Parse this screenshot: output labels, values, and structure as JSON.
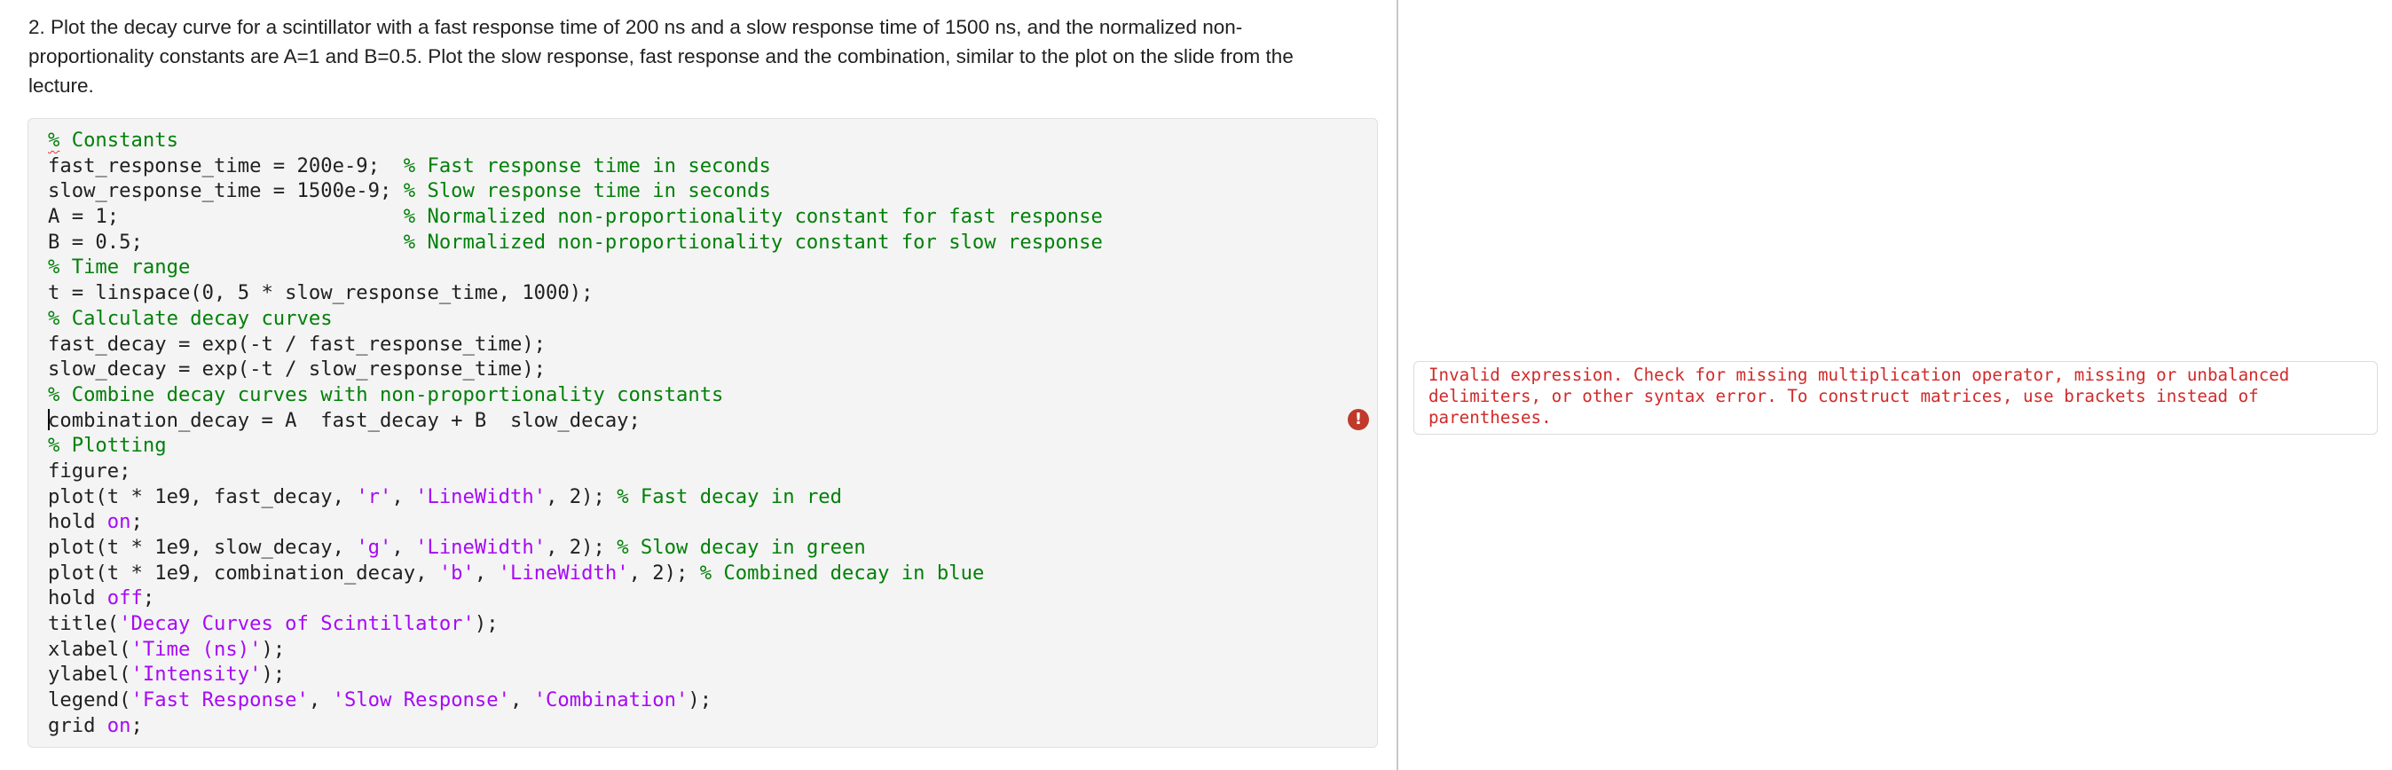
{
  "question": {
    "text": "2. Plot the decay curve for a scintillator with a fast response time of 200 ns and a slow response time of 1500 ns, and the normalized non-proportionality constants are A=1 and B=0.5. Plot the slow response, fast response and the combination, similar to the plot on the slide from the lecture."
  },
  "code": {
    "lines": [
      [
        {
          "t": "% Constants",
          "c": "cm-squiggle"
        }
      ],
      [
        {
          "t": "fast_response_time = 200e-9;  ",
          "c": ""
        },
        {
          "t": "% Fast response time in seconds",
          "c": "cm"
        }
      ],
      [
        {
          "t": "slow_response_time = 1500e-9; ",
          "c": ""
        },
        {
          "t": "% Slow response time in seconds",
          "c": "cm"
        }
      ],
      [
        {
          "t": "A = 1;                        ",
          "c": ""
        },
        {
          "t": "% Normalized non-proportionality constant for fast response",
          "c": "cm"
        }
      ],
      [
        {
          "t": "B = 0.5;                      ",
          "c": ""
        },
        {
          "t": "% Normalized non-proportionality constant for slow response",
          "c": "cm"
        }
      ],
      [
        {
          "t": "% Time range",
          "c": "cm"
        }
      ],
      [
        {
          "t": "t = linspace(0, 5 * slow_response_time, 1000);",
          "c": ""
        }
      ],
      [
        {
          "t": "% Calculate decay curves",
          "c": "cm"
        }
      ],
      [
        {
          "t": "fast_decay = exp(-t / fast_response_time);",
          "c": ""
        }
      ],
      [
        {
          "t": "slow_decay = exp(-t / slow_response_time);",
          "c": ""
        }
      ],
      [
        {
          "t": "% Combine decay curves with non-proportionality constants",
          "c": "cm"
        }
      ],
      [
        {
          "t": "",
          "c": "caret"
        },
        {
          "t": "combination_decay = A  fast_decay + B  slow_decay;",
          "c": ""
        }
      ],
      [
        {
          "t": "% Plotting",
          "c": "cm"
        }
      ],
      [
        {
          "t": "figure;",
          "c": ""
        }
      ],
      [
        {
          "t": "plot(t * 1e9, fast_decay, ",
          "c": ""
        },
        {
          "t": "'r'",
          "c": "st"
        },
        {
          "t": ", ",
          "c": ""
        },
        {
          "t": "'LineWidth'",
          "c": "st"
        },
        {
          "t": ", 2); ",
          "c": ""
        },
        {
          "t": "% Fast decay in red",
          "c": "cm"
        }
      ],
      [
        {
          "t": "hold ",
          "c": ""
        },
        {
          "t": "on",
          "c": "kw"
        },
        {
          "t": ";",
          "c": ""
        }
      ],
      [
        {
          "t": "plot(t * 1e9, slow_decay, ",
          "c": ""
        },
        {
          "t": "'g'",
          "c": "st"
        },
        {
          "t": ", ",
          "c": ""
        },
        {
          "t": "'LineWidth'",
          "c": "st"
        },
        {
          "t": ", 2); ",
          "c": ""
        },
        {
          "t": "% Slow decay in green",
          "c": "cm"
        }
      ],
      [
        {
          "t": "plot(t * 1e9, combination_decay, ",
          "c": ""
        },
        {
          "t": "'b'",
          "c": "st"
        },
        {
          "t": ", ",
          "c": ""
        },
        {
          "t": "'LineWidth'",
          "c": "st"
        },
        {
          "t": ", 2); ",
          "c": ""
        },
        {
          "t": "% Combined decay in blue",
          "c": "cm"
        }
      ],
      [
        {
          "t": "hold ",
          "c": ""
        },
        {
          "t": "off",
          "c": "kw"
        },
        {
          "t": ";",
          "c": ""
        }
      ],
      [
        {
          "t": "title(",
          "c": ""
        },
        {
          "t": "'Decay Curves of Scintillator'",
          "c": "st"
        },
        {
          "t": ");",
          "c": ""
        }
      ],
      [
        {
          "t": "xlabel(",
          "c": ""
        },
        {
          "t": "'Time (ns)'",
          "c": "st"
        },
        {
          "t": ");",
          "c": ""
        }
      ],
      [
        {
          "t": "ylabel(",
          "c": ""
        },
        {
          "t": "'Intensity'",
          "c": "st"
        },
        {
          "t": ");",
          "c": ""
        }
      ],
      [
        {
          "t": "legend(",
          "c": ""
        },
        {
          "t": "'Fast Response'",
          "c": "st"
        },
        {
          "t": ", ",
          "c": ""
        },
        {
          "t": "'Slow Response'",
          "c": "st"
        },
        {
          "t": ", ",
          "c": ""
        },
        {
          "t": "'Combination'",
          "c": "st"
        },
        {
          "t": ");",
          "c": ""
        }
      ],
      [
        {
          "t": "grid ",
          "c": ""
        },
        {
          "t": "on",
          "c": "kw"
        },
        {
          "t": ";",
          "c": ""
        }
      ]
    ],
    "error_line_index": 11,
    "error_icon": "error-exclamation-icon"
  },
  "error_panel": {
    "message": "Invalid expression. Check for missing multiplication operator, missing or unbalanced delimiters, or other syntax error. To construct matrices, use brackets instead of parentheses."
  },
  "colors": {
    "comment": "#028009",
    "string": "#a709f5",
    "error": "#d12a2a",
    "error_icon": "#c0392b"
  }
}
